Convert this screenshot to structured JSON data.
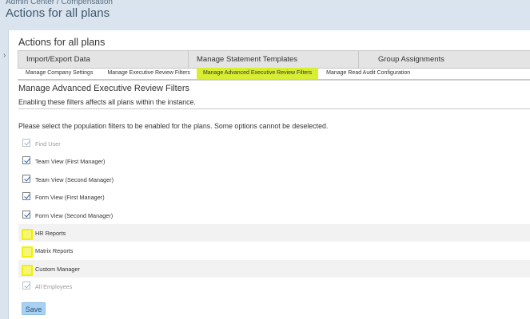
{
  "header": {
    "breadcrumb": "Admin Center / Compensation",
    "title": "Actions for all plans"
  },
  "panel": {
    "title": "Actions for all plans",
    "primary_tabs": [
      {
        "label": "Import/Export Data"
      },
      {
        "label": "Manage Statement Templates"
      },
      {
        "label": "Group Assignments"
      }
    ],
    "secondary_tabs": [
      {
        "label": "Manage Company Settings",
        "active": false
      },
      {
        "label": "Manage Executive Review Filters",
        "active": false
      },
      {
        "label": "Manage Advanced Executive Review Filters",
        "active": true
      },
      {
        "label": "Manage Read Audit Configuration",
        "active": false
      }
    ]
  },
  "section": {
    "title": "Manage Advanced Executive Review Filters",
    "description": "Enabling these filters affects all plans within the instance.",
    "instruction": "Please select the population filters to be enabled for the plans. Some options cannot be deselected."
  },
  "filters": [
    {
      "label": "Find User",
      "checked": true,
      "disabled": true
    },
    {
      "label": "Team View (First Manager)",
      "checked": true,
      "disabled": false
    },
    {
      "label": "Team View (Second Manager)",
      "checked": true,
      "disabled": false
    },
    {
      "label": "Form View (First Manager)",
      "checked": true,
      "disabled": false
    },
    {
      "label": "Form View (Second Manager)",
      "checked": true,
      "disabled": false
    },
    {
      "label": "HR Reports",
      "checked": false,
      "disabled": false,
      "highlighted": true
    },
    {
      "label": "Matrix Reports",
      "checked": false,
      "disabled": false,
      "highlighted": true
    },
    {
      "label": "Custom Manager",
      "checked": false,
      "disabled": false,
      "highlighted": true
    },
    {
      "label": "All Employees",
      "checked": true,
      "disabled": true
    }
  ],
  "actions": {
    "save_label": "Save"
  },
  "colors": {
    "active_tab_highlight": "#d7ee32",
    "checkbox_highlight": "#f5f57a",
    "save_button": "#a9d1f1",
    "page_background": "#d9e4ee"
  }
}
